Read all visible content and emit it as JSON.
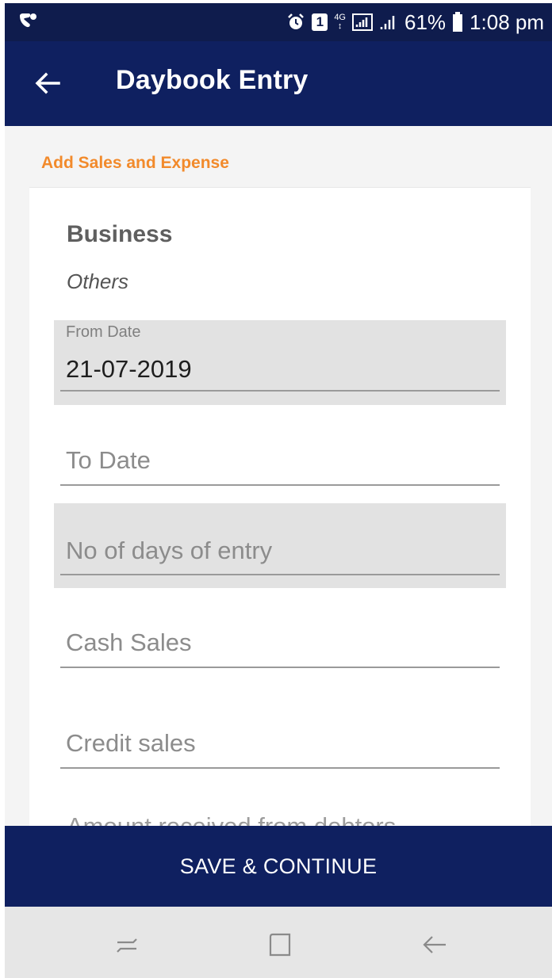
{
  "status_bar": {
    "battery": "61%",
    "time": "1:08 pm",
    "network": "4G",
    "sim_slot": "1",
    "icons": [
      "app-notification-icon",
      "alarm-icon",
      "sim-1-icon",
      "network-4g-icon",
      "signal-icon",
      "signal-2-icon",
      "battery-icon"
    ]
  },
  "app_bar": {
    "title": "Daybook Entry",
    "back_icon": "back-arrow-icon"
  },
  "form": {
    "section_label": "Add Sales and Expense",
    "business_title": "Business",
    "business_value": "Others",
    "from_date": {
      "label": "From Date",
      "value": "21-07-2019"
    },
    "to_date": {
      "placeholder": "To Date"
    },
    "days_entry": {
      "placeholder": "No of days of entry"
    },
    "cash_sales": {
      "placeholder": "Cash Sales"
    },
    "credit_sales": {
      "placeholder": "Credit sales"
    },
    "debtors": {
      "placeholder": "Amount received from debtors"
    }
  },
  "save_button": {
    "label": "SAVE & CONTINUE"
  },
  "nav_bar": {
    "icons": [
      "recent-apps-icon",
      "home-icon",
      "nav-back-icon"
    ]
  },
  "colors": {
    "primary": "#0f2060",
    "status_bar": "#0f1c4d",
    "accent": "#f28a2b",
    "shaded_field": "#e2e2e2"
  }
}
